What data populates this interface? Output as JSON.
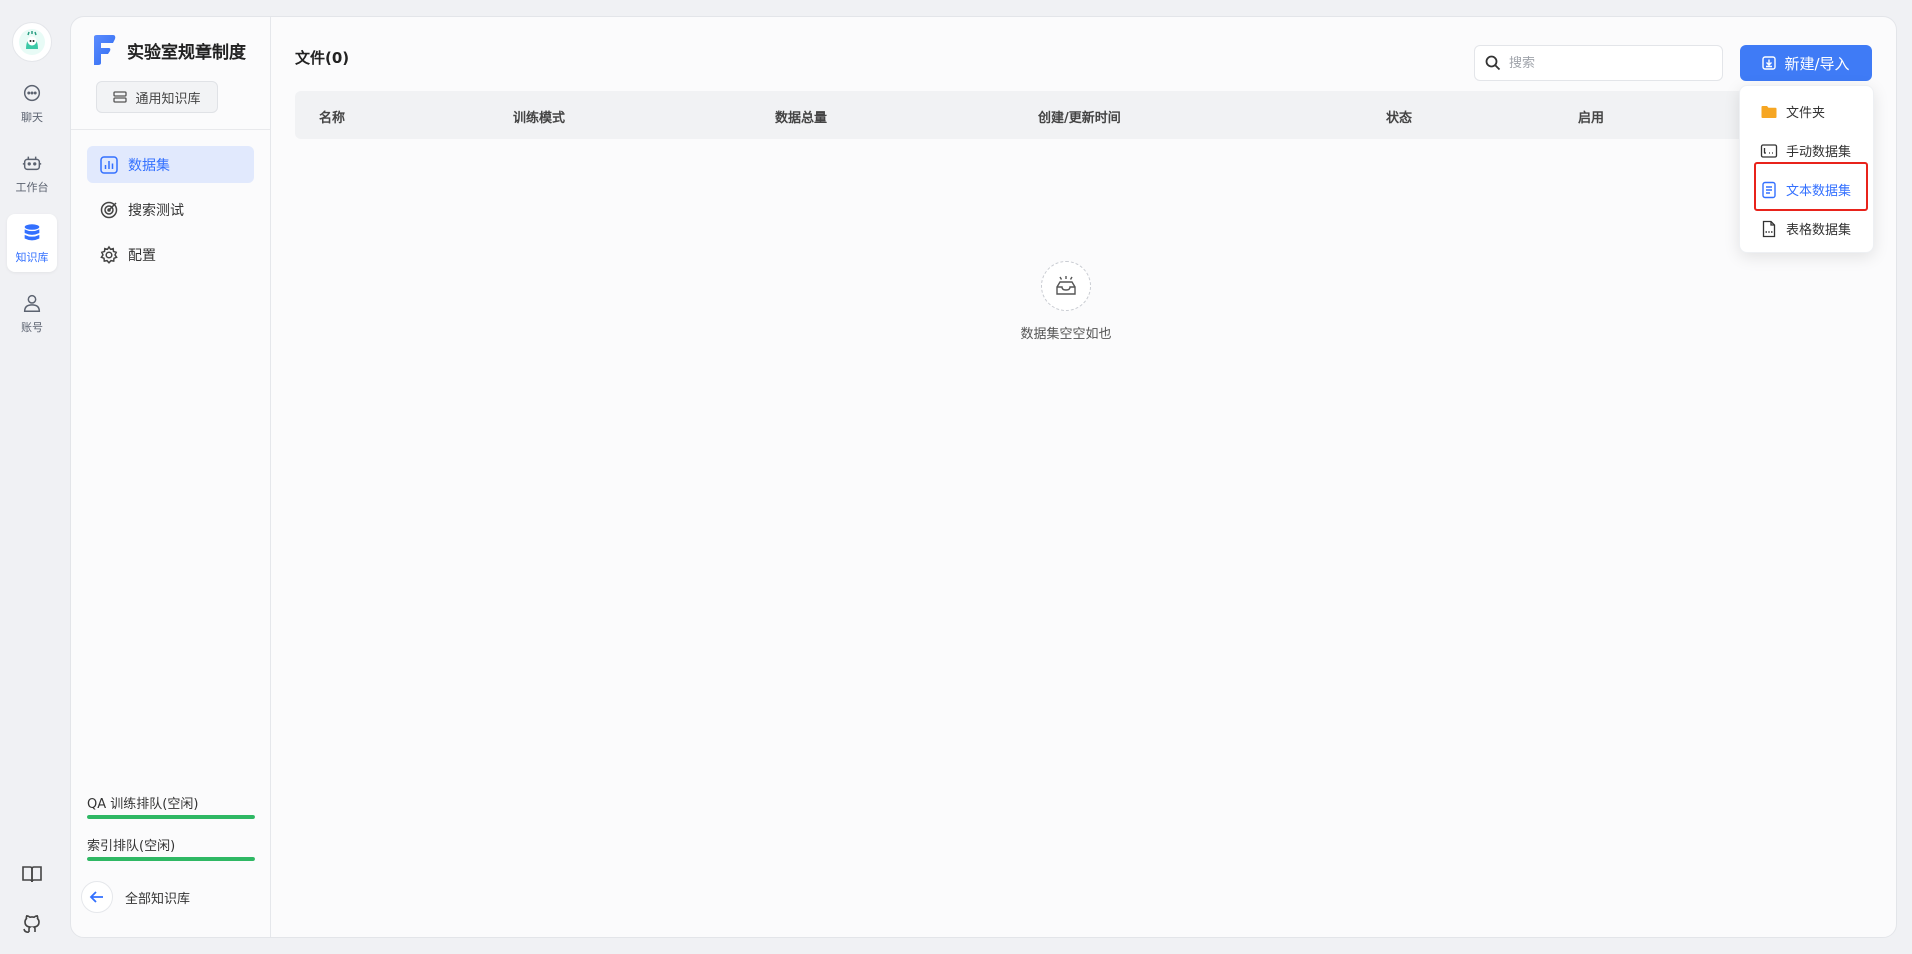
{
  "rail": {
    "items": [
      {
        "label": "聊天",
        "icon": "chat-bubble-icon",
        "active": false
      },
      {
        "label": "工作台",
        "icon": "robot-icon",
        "active": false
      },
      {
        "label": "知识库",
        "icon": "database-icon",
        "active": true
      },
      {
        "label": "账号",
        "icon": "user-icon",
        "active": false
      }
    ],
    "bottom_icons": [
      "book-icon",
      "github-icon"
    ]
  },
  "sidebar": {
    "kb_title": "实验室规章制度",
    "kb_type": "通用知识库",
    "menu": [
      {
        "label": "数据集",
        "icon": "chart-icon",
        "active": true
      },
      {
        "label": "搜索测试",
        "icon": "target-icon",
        "active": false
      },
      {
        "label": "配置",
        "icon": "gear-icon",
        "active": false
      }
    ],
    "queues": [
      {
        "label": "QA 训练排队(空闲)",
        "progress": 1.0
      },
      {
        "label": "索引排队(空闲)",
        "progress": 1.0
      }
    ],
    "back_label": "全部知识库"
  },
  "main": {
    "title": "文件(0)",
    "search_placeholder": "搜索",
    "new_button": "新建/导入",
    "columns": [
      "名称",
      "训练模式",
      "数据总量",
      "创建/更新时间",
      "状态",
      "启用"
    ],
    "empty_text": "数据集空空如也"
  },
  "dropdown": {
    "items": [
      {
        "label": "文件夹",
        "icon": "folder-icon"
      },
      {
        "label": "手动数据集",
        "icon": "manual-dataset-icon"
      },
      {
        "label": "文本数据集",
        "icon": "text-dataset-icon",
        "highlighted": true
      },
      {
        "label": "表格数据集",
        "icon": "csv-dataset-icon"
      }
    ]
  },
  "colors": {
    "accent": "#3370ff",
    "button": "#3f7bf6",
    "queue_fill": "#2fb864",
    "highlight_box": "#e8231b",
    "folder": "#f6a623"
  }
}
